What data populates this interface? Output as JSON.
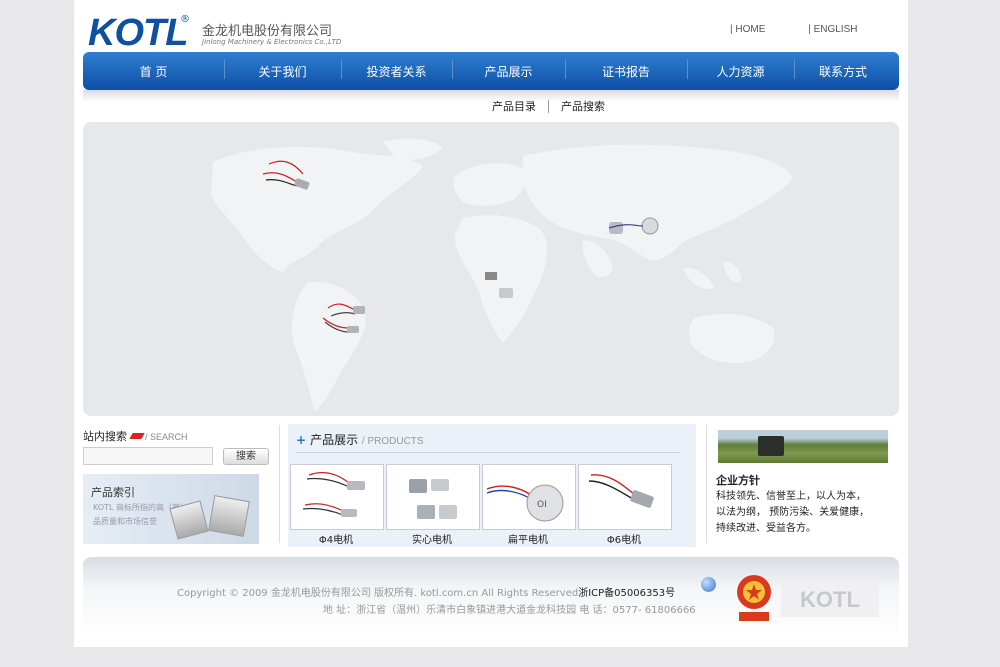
{
  "header": {
    "logo_text": "KOTL",
    "logo_reg": "®",
    "company_cn": "金龙机电股份有限公司",
    "company_en": "Jinlong Machinery & Electronics Co.,LTD",
    "links": [
      "HOME",
      "ENGLISH"
    ]
  },
  "nav": {
    "items": [
      "首 页",
      "关于我们",
      "投资者关系",
      "产品展示",
      "证书报告",
      "人力资源",
      "联系方式"
    ]
  },
  "subnav": {
    "items": [
      "产品目录",
      "产品搜索"
    ]
  },
  "search": {
    "title": "站内搜索",
    "title_en": "/ SEARCH",
    "button": "搜索",
    "value": ""
  },
  "index": {
    "title": "产品索引",
    "desc_line1": "KOTL 商标所指的高（亮）",
    "desc_line2": "品质量和市场信誉"
  },
  "products": {
    "title": "产品展示",
    "title_en": "/ PRODUCTS",
    "items": [
      {
        "label": "Φ4电机"
      },
      {
        "label": "实心电机"
      },
      {
        "label": "扁平电机"
      },
      {
        "label": "Φ6电机"
      }
    ]
  },
  "corporate": {
    "title": "企业方针",
    "lines": [
      "科技领先、信誉至上，以人为本，",
      "以法为纲， 预防污染、关爱健康，",
      "持续改进、受益各方。"
    ]
  },
  "footer": {
    "copyright": "Copyright © 2009 金龙机电股份有限公司 版权所有. kotl.com.cn All Rights Reserved",
    "icp": "浙ICP备05006353号",
    "address": "地 址：浙江省（温州）乐清市白象镇进港大道金龙科技园 电 话：0577- 61806666",
    "logo_text": "KOTL"
  },
  "colors": {
    "brand_blue": "#1050a0",
    "nav_top": "#2f7fd0",
    "nav_bottom": "#0e4fa7",
    "flag_red": "#d22"
  }
}
